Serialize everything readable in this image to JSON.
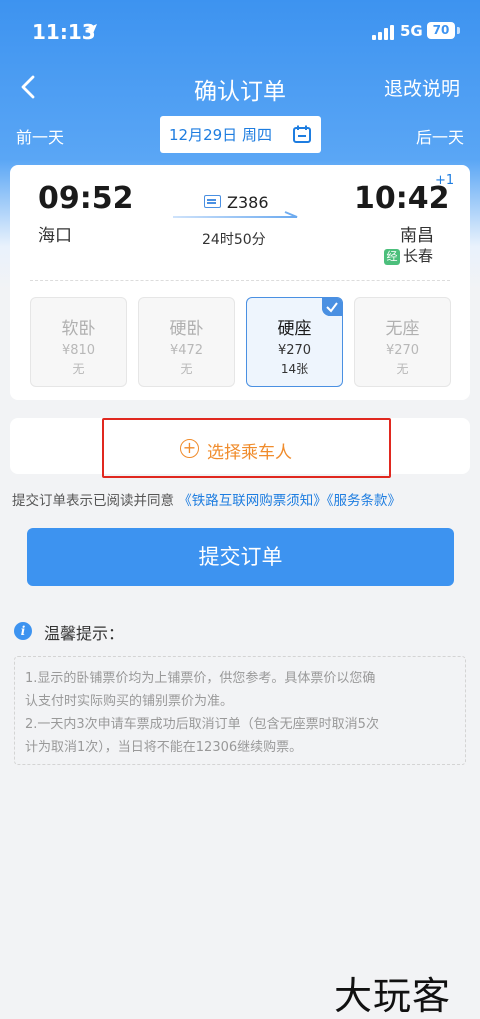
{
  "status_bar": {
    "time": "11:13",
    "network": "5G",
    "battery": "70"
  },
  "nav": {
    "title": "确认订单",
    "right_link": "退改说明"
  },
  "date_bar": {
    "prev": "前一天",
    "date": "12月29日 周四",
    "next": "后一天"
  },
  "train": {
    "number": "Z386",
    "departure_time": "09:52",
    "departure_station": "海口",
    "arrival_time": "10:42",
    "arrival_day_offset": "+1",
    "arrival_station": "南昌",
    "via_tag": "经",
    "via_station": "长春",
    "duration": "24时50分"
  },
  "seats": [
    {
      "name": "软卧",
      "price": "¥810",
      "count": "无",
      "selected": false
    },
    {
      "name": "硬卧",
      "price": "¥472",
      "count": "无",
      "selected": false
    },
    {
      "name": "硬座",
      "price": "¥270",
      "count": "14张",
      "selected": true
    },
    {
      "name": "无座",
      "price": "¥270",
      "count": "无",
      "selected": false
    }
  ],
  "passenger": {
    "add_icon": "plus-circle-icon",
    "label": "选择乘车人"
  },
  "agreement": {
    "prefix": "提交订单表示已阅读并同意",
    "link1": "《铁路互联网购票须知》",
    "link2": "《服务条款》"
  },
  "submit_label": "提交订单",
  "tips": {
    "icon": "i",
    "title": "温馨提示：",
    "lines": [
      "1.显示的卧铺票价均为上铺票价，供您参考。具体票价以您确",
      "认支付时实际购买的铺别票价为准。",
      "2.一天内3次申请车票成功后取消订单（包含无座票时取消5次",
      "计为取消1次），当日将不能在12306继续购票。"
    ]
  },
  "watermark": "大玩客",
  "colors": {
    "primary": "#3d93f0",
    "link": "#1e7de0",
    "accent_orange": "#f08c2c",
    "highlight_red": "#e0281f"
  }
}
